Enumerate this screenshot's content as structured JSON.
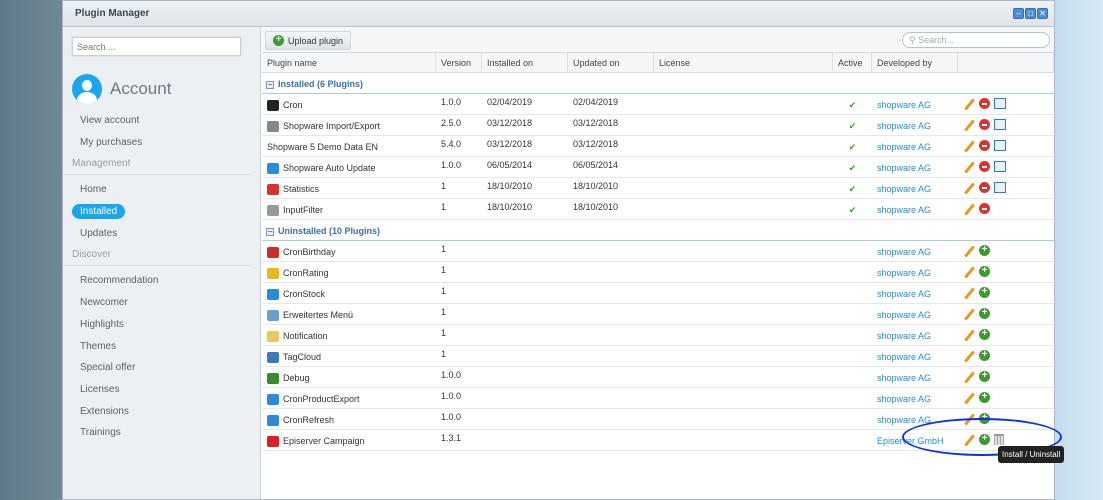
{
  "window": {
    "title": "Plugin Manager"
  },
  "sidebar": {
    "search_placeholder": "Search ...",
    "account_title": "Account",
    "account_items": [
      "View account",
      "My purchases"
    ],
    "management_header": "Management",
    "management_items": [
      "Home",
      "Installed",
      "Updates"
    ],
    "discover_header": "Discover",
    "discover_items": [
      "Recommendation",
      "Newcomer",
      "Highlights",
      "Themes",
      "Special offer",
      "Licenses",
      "Extensions",
      "Trainings"
    ]
  },
  "toolbar": {
    "upload_label": "Upload plugin",
    "search_placeholder": "Search..."
  },
  "columns": [
    "Plugin name",
    "Version",
    "Installed on",
    "Updated on",
    "License",
    "Active",
    "Developed by"
  ],
  "installed": {
    "header": "Installed (6 Plugins)",
    "rows": [
      {
        "name": "Cron",
        "version": "1.0.0",
        "installed": "02/04/2019",
        "updated": "02/04/2019",
        "active": "✔",
        "dev": "shopware AG",
        "icon": "terminal",
        "color": "#222",
        "update": true
      },
      {
        "name": "Shopware Import/Export",
        "version": "2.5.0",
        "installed": "03/12/2018",
        "updated": "03/12/2018",
        "active": "✔",
        "dev": "shopware AG",
        "icon": "import",
        "color": "#888",
        "update": true
      },
      {
        "name": "Shopware 5 Demo Data EN",
        "version": "5.4.0",
        "installed": "03/12/2018",
        "updated": "03/12/2018",
        "active": "✔",
        "dev": "shopware AG",
        "icon": "",
        "color": "",
        "update": true
      },
      {
        "name": "Shopware Auto Update",
        "version": "1.0.0",
        "installed": "06/05/2014",
        "updated": "06/05/2014",
        "active": "✔",
        "dev": "shopware AG",
        "icon": "refresh",
        "color": "#2a8bd8",
        "update": true
      },
      {
        "name": "Statistics",
        "version": "1",
        "installed": "18/10/2010",
        "updated": "18/10/2010",
        "active": "✔",
        "dev": "shopware AG",
        "icon": "pie-chart",
        "color": "#d9342b",
        "update": true
      },
      {
        "name": "InputFilter",
        "version": "1",
        "installed": "18/10/2010",
        "updated": "18/10/2010",
        "active": "✔",
        "dev": "shopware AG",
        "icon": "filter",
        "color": "#999",
        "update": false
      }
    ]
  },
  "uninstalled": {
    "header": "Uninstalled (10 Plugins)",
    "rows": [
      {
        "name": "CronBirthday",
        "version": "1",
        "dev": "shopware AG",
        "icon": "gift",
        "color": "#c8302a"
      },
      {
        "name": "CronRating",
        "version": "1",
        "dev": "shopware AG",
        "icon": "star",
        "color": "#e8b820"
      },
      {
        "name": "CronStock",
        "version": "1",
        "dev": "shopware AG",
        "icon": "chart",
        "color": "#2a8bd8"
      },
      {
        "name": "Erweitertes Menü",
        "version": "1",
        "dev": "shopware AG",
        "icon": "menu",
        "color": "#6aa0d0"
      },
      {
        "name": "Notification",
        "version": "1",
        "dev": "shopware AG",
        "icon": "comment",
        "color": "#e8c860"
      },
      {
        "name": "TagCloud",
        "version": "1",
        "dev": "shopware AG",
        "icon": "cloud",
        "color": "#3a7ab8"
      },
      {
        "name": "Debug",
        "version": "1.0.0",
        "dev": "shopware AG",
        "icon": "bug",
        "color": "#3c8a2e"
      },
      {
        "name": "CronProductExport",
        "version": "1.0.0",
        "dev": "shopware AG",
        "icon": "export",
        "color": "#2a8bd8"
      },
      {
        "name": "CronRefresh",
        "version": "1.0.0",
        "dev": "shopware AG",
        "icon": "clock",
        "color": "#2a8bd8"
      },
      {
        "name": "Episerver Campaign",
        "version": "1.3.1",
        "dev": "Episerver GmbH",
        "icon": "episerver",
        "color": "#e02020",
        "trash": true
      }
    ]
  },
  "tooltip": "Install / Uninstall"
}
